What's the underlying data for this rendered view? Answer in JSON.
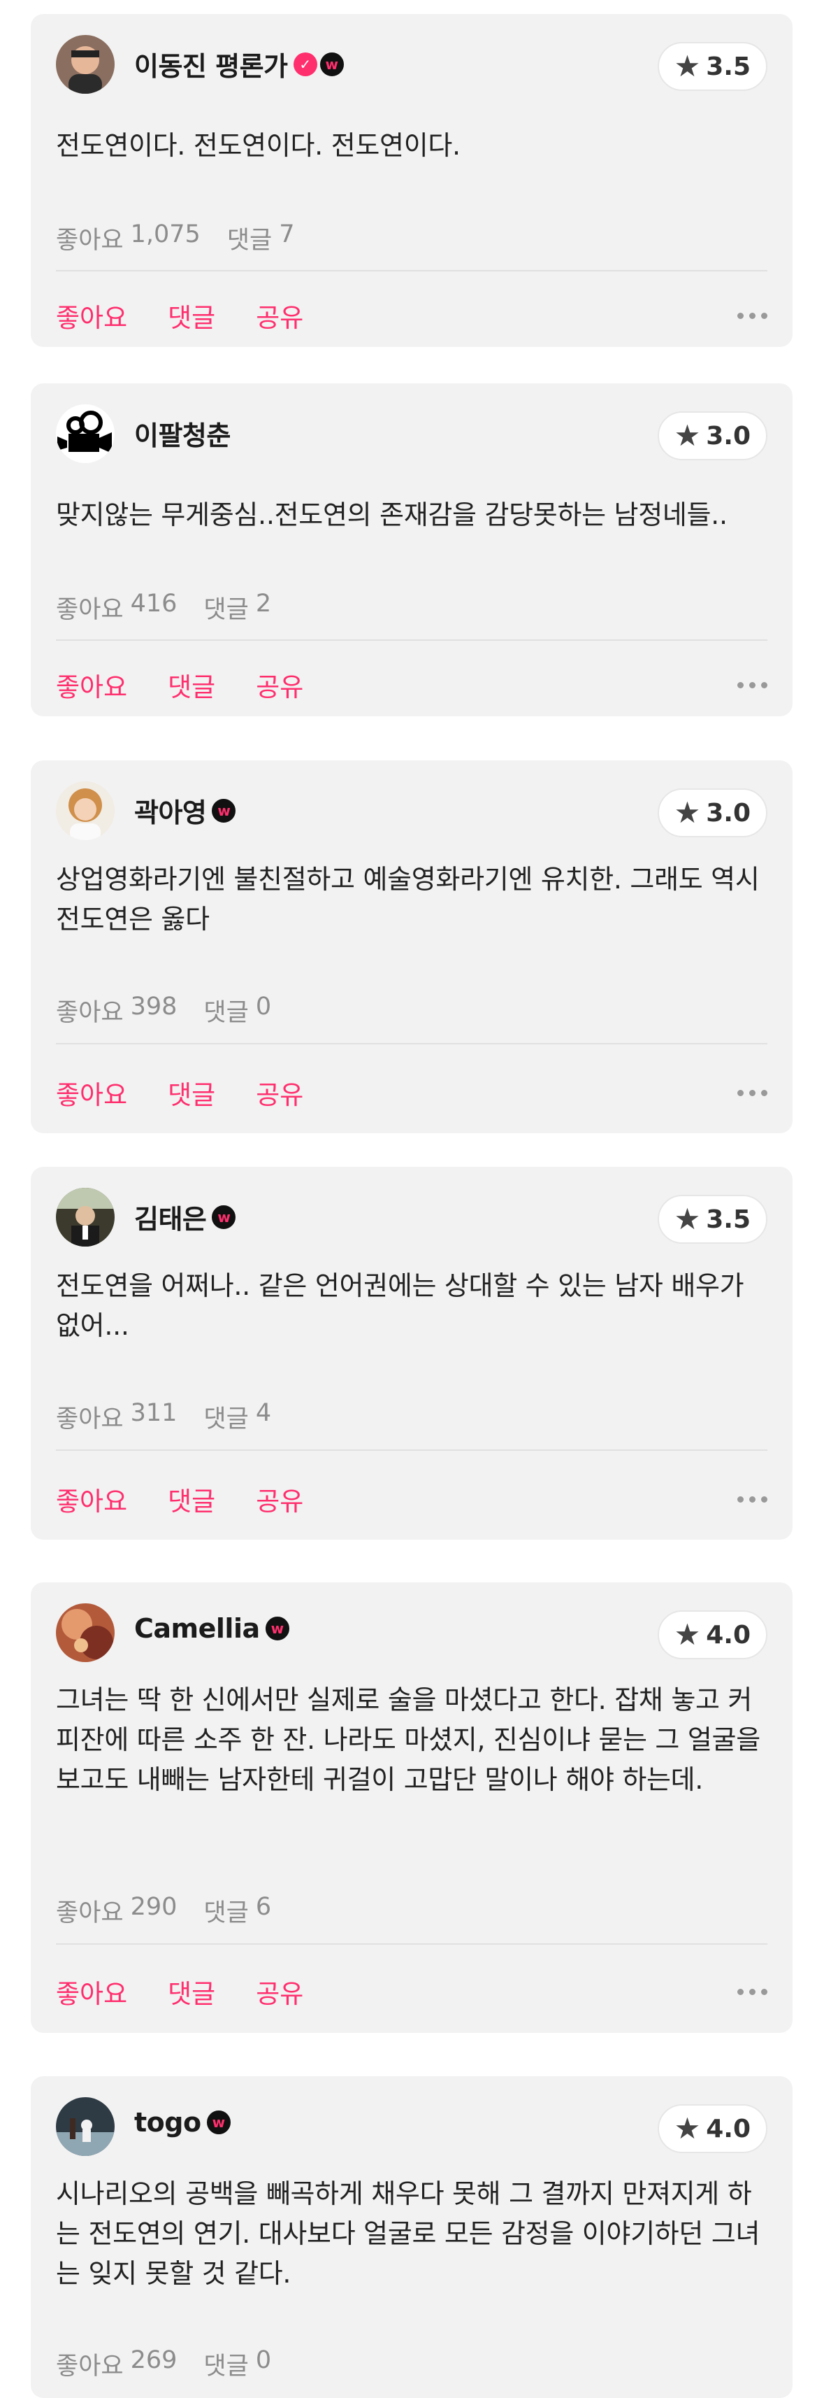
{
  "labels": {
    "like": "좋아요",
    "comment": "댓글",
    "share": "공유"
  },
  "colors": {
    "accent": "#ff2f6e",
    "card_bg": "#f2f2f2"
  },
  "reviews": [
    {
      "username": "이동진 평론가",
      "badges": [
        "verified-check",
        "watcha-w"
      ],
      "rating": "3.5",
      "text": "전도연이다. 전도연이다. 전도연이다.",
      "likes_label": "좋아요",
      "likes": "1,075",
      "comments_label": "댓글",
      "comments": "7"
    },
    {
      "username": "이팔청춘",
      "badges": [],
      "rating": "3.0",
      "text": "맞지않는 무게중심..전도연의 존재감을 감당못하는 남정네들..",
      "likes_label": "좋아요",
      "likes": "416",
      "comments_label": "댓글",
      "comments": "2"
    },
    {
      "username": "곽아영",
      "badges": [
        "watcha-w"
      ],
      "rating": "3.0",
      "text": "상업영화라기엔 불친절하고 예술영화라기엔 유치한. 그래도 역시 전도연은 옳다",
      "likes_label": "좋아요",
      "likes": "398",
      "comments_label": "댓글",
      "comments": "0"
    },
    {
      "username": "김태은",
      "badges": [
        "watcha-w"
      ],
      "rating": "3.5",
      "text": "전도연을 어쩌나.. 같은 언어권에는 상대할 수 있는 남자 배우가 없어...",
      "likes_label": "좋아요",
      "likes": "311",
      "comments_label": "댓글",
      "comments": "4"
    },
    {
      "username": "Camellia",
      "badges": [
        "watcha-w"
      ],
      "rating": "4.0",
      "text": "그녀는 딱 한 신에서만 실제로 술을 마셨다고 한다. 잡채 놓고 커피잔에 따른 소주 한 잔. 나라도 마셨지, 진심이냐 묻는 그 얼굴을 보고도 내빼는 남자한테 귀걸이 고맙단 말이나 해야 하는데.",
      "likes_label": "좋아요",
      "likes": "290",
      "comments_label": "댓글",
      "comments": "6"
    },
    {
      "username": "togo",
      "badges": [
        "watcha-w"
      ],
      "rating": "4.0",
      "text": "시나리오의 공백을 빼곡하게 채우다 못해 그 결까지 만져지게 하는 전도연의 연기. 대사보다 얼굴로 모든 감정을 이야기하던 그녀는 잊지 못할 것 같다.",
      "likes_label": "좋아요",
      "likes": "269",
      "comments_label": "댓글",
      "comments": "0"
    }
  ]
}
